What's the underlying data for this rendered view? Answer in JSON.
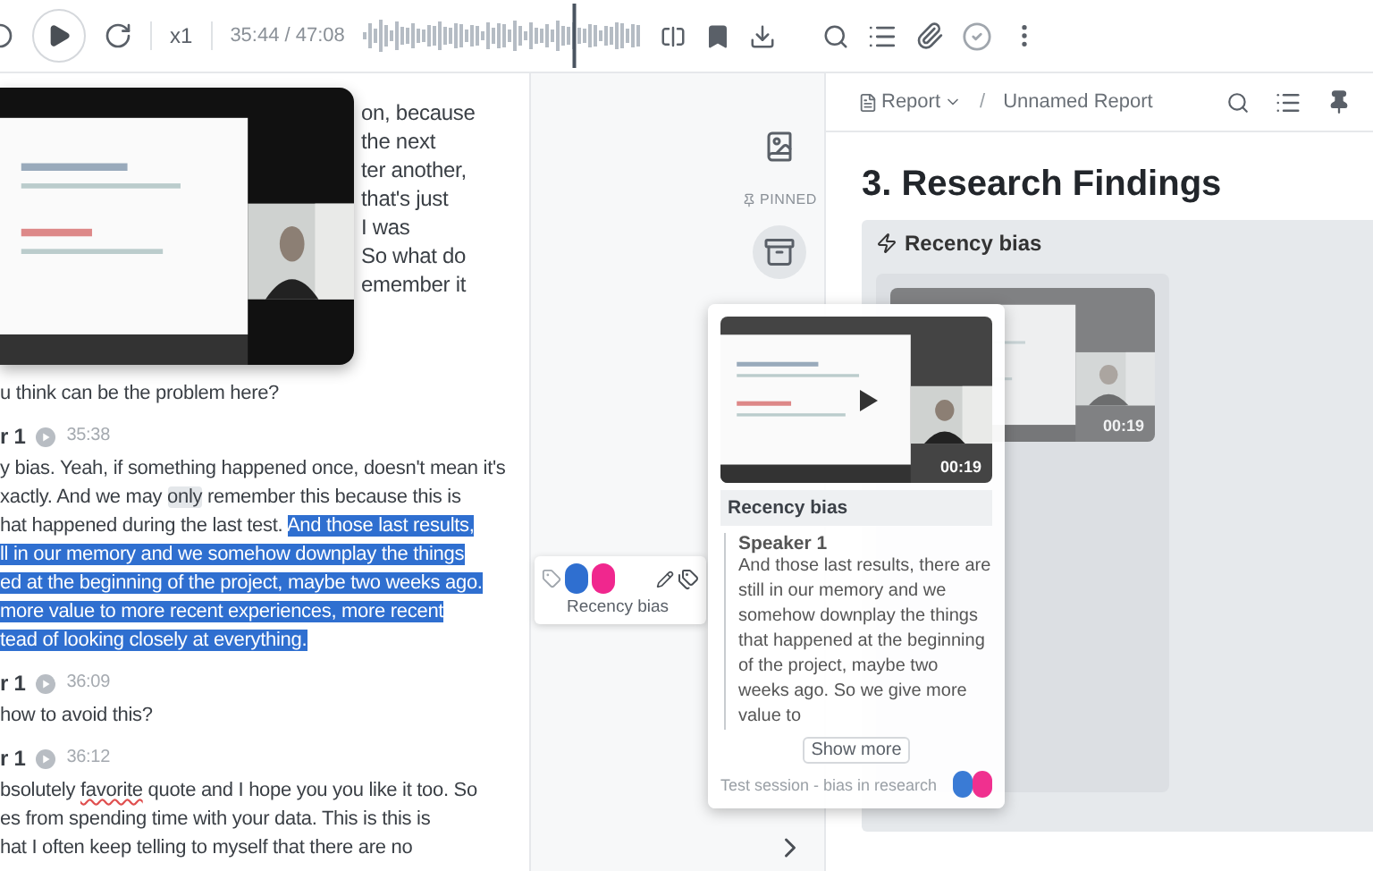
{
  "player": {
    "speed": "x1",
    "time": "35:44 / 47:08",
    "level": 0.758
  },
  "transcript": {
    "fragments": [
      "on, because",
      "the next",
      "ter another,",
      "that's just",
      "I was",
      "So what do",
      "emember it"
    ],
    "blocks": [
      {
        "lines": [
          [
            {
              "text": "u think can be the problem here?"
            }
          ]
        ]
      },
      {
        "speaker": "r 1",
        "time": "35:38",
        "lines": [
          [
            {
              "text": "y bias. Yeah, if something happened once, doesn't mean it's"
            }
          ],
          [
            {
              "text": "xactly. And we may "
            },
            {
              "text": "only",
              "hovered": true
            },
            {
              "text": " remember this because this is"
            }
          ],
          [
            {
              "text": "hat happened during the last test. "
            },
            {
              "text": "And those last results,",
              "selected": true
            }
          ],
          [
            {
              "text": "ll in our memory and we somehow downplay the things",
              "selected": true
            }
          ],
          [
            {
              "text": "ed at the beginning of the project, maybe two weeks ago.",
              "selected": true
            }
          ],
          [
            {
              "text": "more value to more recent experiences, more recent",
              "selected": true
            }
          ],
          [
            {
              "text": "tead of looking closely at  everything.",
              "selected": true
            }
          ]
        ]
      },
      {
        "speaker": "r 1",
        "time": "36:09",
        "lines": [
          [
            {
              "text": "how to avoid this?"
            }
          ]
        ]
      },
      {
        "speaker": "r 1",
        "time": "36:12",
        "lines": [
          [
            {
              "text": "bsolutely "
            },
            {
              "text": "favorite",
              "misspelled": true
            },
            {
              "text": " quote and I hope you you like it too. So"
            }
          ],
          [
            {
              "text": "es from spending time with your data. This is this is"
            }
          ],
          [
            {
              "text": "hat I often keep telling to myself that there are no"
            }
          ]
        ]
      }
    ]
  },
  "sidebar": {
    "pinned_label": "PINNED",
    "items": [
      {
        "kind": "gallery",
        "selected": false
      },
      {
        "kind": "cabinet",
        "selected": true
      }
    ]
  },
  "tag_chip": {
    "label": "Recency bias",
    "tags": [
      {
        "color": "#2f6fd0"
      },
      {
        "color": "#f0278e"
      }
    ]
  },
  "report": {
    "menu": "Report",
    "separator": "/",
    "title": "Unnamed Report",
    "heading": "3. Research Findings",
    "section": "Recency bias",
    "card_duration": "00:19"
  },
  "drag_card": {
    "duration": "00:19",
    "title": "Recency bias",
    "speaker": "Speaker 1",
    "quote": "And those last results, there are still in our memory and we somehow downplay the things that happened at the beginning of the project, maybe two weeks ago. So we give more value to",
    "more": "Show more",
    "source": "Test session - bias in research",
    "tags": [
      {
        "color": "#3a7bd5"
      },
      {
        "color": "#f0308f"
      }
    ]
  }
}
